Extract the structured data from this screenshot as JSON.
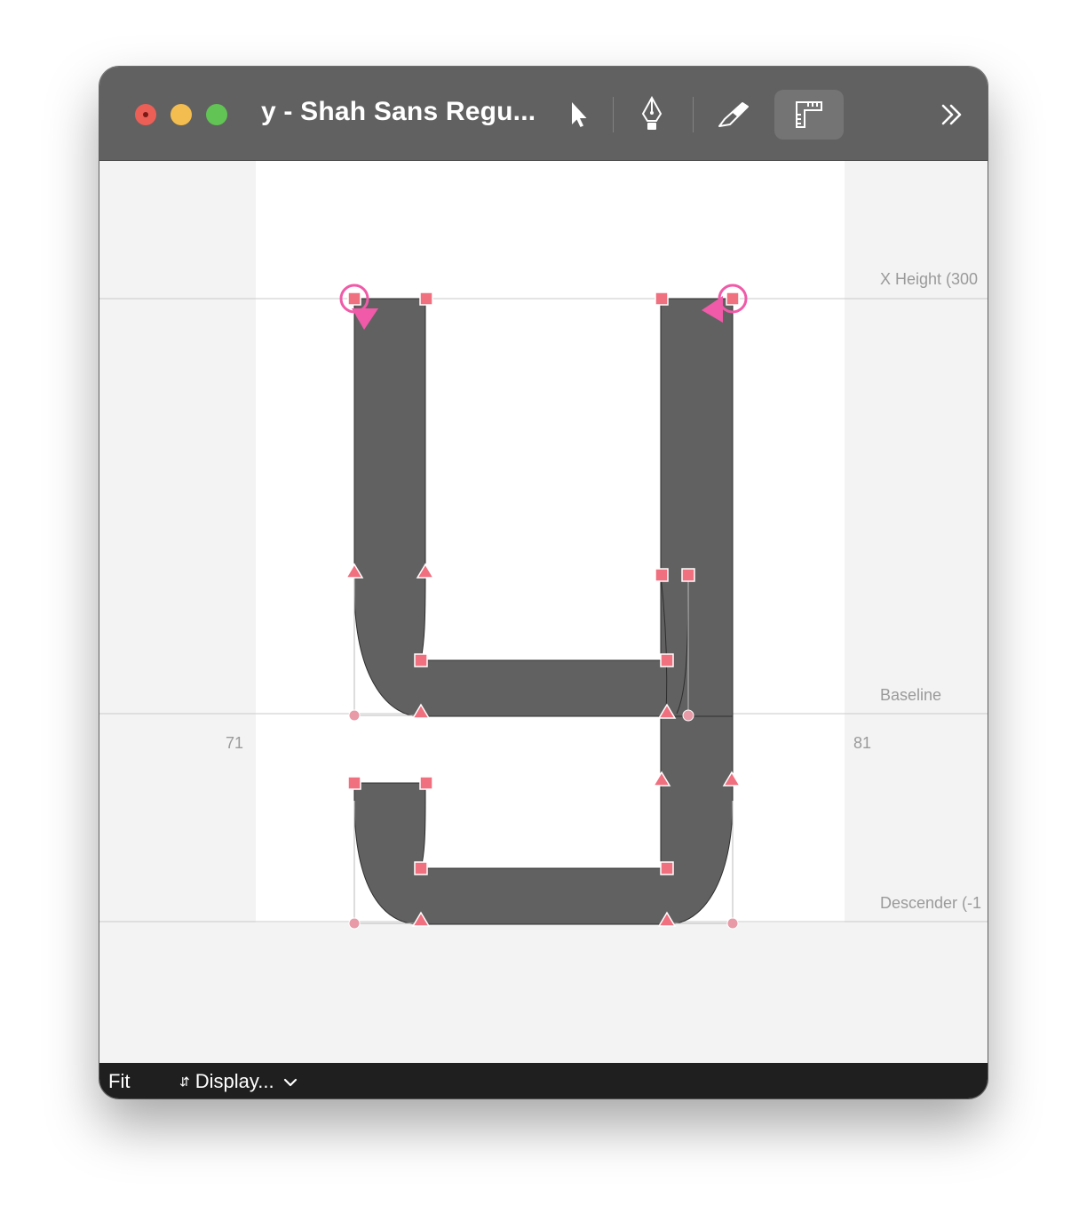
{
  "window": {
    "title": "y - Shah Sans Regu..."
  },
  "toolbar": {
    "tools": [
      {
        "name": "select-tool",
        "icon": "arrow-pointer-icon"
      },
      {
        "name": "pen-tool",
        "icon": "pen-nib-icon"
      },
      {
        "name": "knife-tool",
        "icon": "knife-icon"
      },
      {
        "name": "measure-tool",
        "icon": "ruler-icon",
        "active": true
      }
    ],
    "overflow_icon": "double-chevron-right-icon"
  },
  "canvas": {
    "metrics": {
      "x_height": "X Height (300",
      "baseline": "Baseline",
      "descender": "Descender (-1"
    },
    "left_sidebearing": "71",
    "right_sidebearing": "81",
    "colors": {
      "glyph_fill": "#616161",
      "node": "#f07080",
      "start_node": "#f05aa8",
      "sidebearing_area": "#f3f3f3",
      "advance_area": "#ffffff"
    }
  },
  "statusbar": {
    "zoom": "Fit",
    "display_menu": "Display..."
  }
}
